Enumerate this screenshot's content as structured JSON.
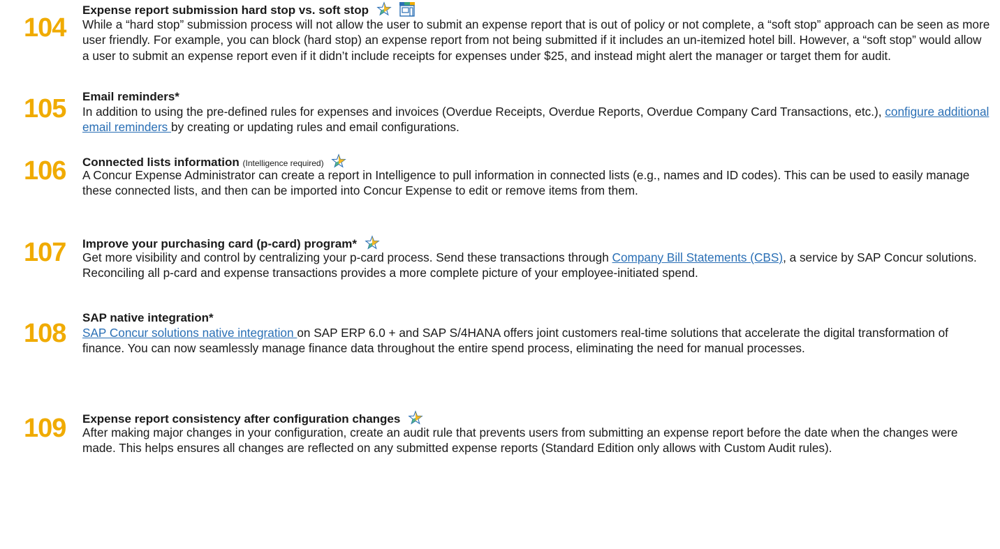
{
  "tips": [
    {
      "number": "104",
      "title": "Expense report submission hard stop vs. soft stop",
      "body": "While a “hard stop” submission process will not allow the user to submit an expense report that is out of policy or not complete, a “soft stop” approach can be seen as more user friendly. For example, you can block (hard stop) an expense report from not being submitted if it includes an un-itemized hotel bill. However, a “soft stop” would allow a user to submit an expense report even if it didn’t include receipts for expenses under $25, and instead might alert the manager or target them for audit."
    },
    {
      "number": "105",
      "title": "Email reminders*",
      "body_before": "In addition to using the pre-defined rules for expenses and invoices (Overdue Receipts, Overdue Reports, Overdue Company Card Transactions, etc.), ",
      "link": "configure additional email reminders ",
      "body_after": "by creating or updating rules and email configurations."
    },
    {
      "number": "106",
      "title": "Connected lists information",
      "note": "(Intelligence required)",
      "body": "A Concur Expense Administrator can create a report in Intelligence to pull information in connected lists (e.g., names and ID codes). This can be used to easily manage these connected lists, and then can be imported into Concur Expense to edit or remove items from them."
    },
    {
      "number": "107",
      "title": "Improve your purchasing card (p-card) program*",
      "body_before": "Get more visibility and control by centralizing your p-card process. Send these transactions through ",
      "link": "Company Bill Statements (CBS)",
      "body_after": ", a service by SAP Concur solutions. Reconciling all p-card and expense transactions provides a more complete picture of your employee-initiated spend."
    },
    {
      "number": "108",
      "title": "SAP native integration*",
      "link": "SAP Concur solutions native integration ",
      "body_after": "on SAP ERP 6.0 + and SAP S/4HANA offers joint customers real-time solutions that accelerate the digital transformation of finance. You can now seamlessly manage finance data throughout the entire spend process, eliminating the need for manual processes."
    },
    {
      "number": "109",
      "title": "Expense report consistency after configuration changes",
      "body": "After making major changes in your configuration, create an audit rule that prevents users from submitting an expense report before the date when the changes were made. This helps ensures all changes are reflected on any submitted expense reports (Standard Edition only allows with Custom Audit rules)."
    }
  ],
  "icons": {
    "star": "star-icon",
    "store": "store-icon"
  },
  "colors": {
    "number": "#f0ab00",
    "link": "#2a6fb5",
    "text": "#1a1a1a"
  }
}
